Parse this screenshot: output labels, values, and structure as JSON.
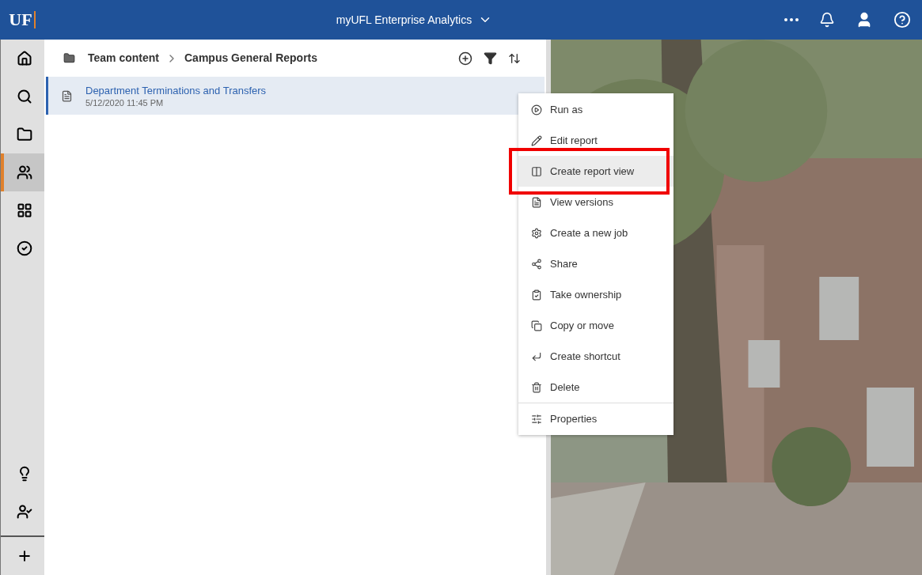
{
  "top_bar": {
    "logo": "UF",
    "title": "myUFL Enterprise Analytics"
  },
  "sidebar": {
    "items": [
      {
        "kind": "home",
        "selected": false
      },
      {
        "kind": "search",
        "selected": false
      },
      {
        "kind": "my-content",
        "selected": false
      },
      {
        "kind": "team-content",
        "selected": true
      },
      {
        "kind": "layout",
        "selected": false
      },
      {
        "kind": "check",
        "selected": false
      }
    ],
    "bottom_items": [
      {
        "kind": "bulb",
        "selected": false
      },
      {
        "kind": "user",
        "selected": false
      },
      {
        "kind": "plus",
        "selected": false
      }
    ]
  },
  "breadcrumb": [
    "Team content",
    "Campus General Reports"
  ],
  "files": [
    {
      "name": "Department Terminations and Transfers",
      "modified": "5/12/2020 11:45 PM",
      "selected": true
    }
  ],
  "context_menu": {
    "items": [
      {
        "kind": "run",
        "label": "Run as",
        "hovered": false,
        "outlined": false
      },
      {
        "kind": "edit",
        "label": "Edit report",
        "hovered": false,
        "outlined": false
      },
      {
        "kind": "report-view",
        "label": "Create report view",
        "hovered": true,
        "outlined": true
      },
      {
        "kind": "versions",
        "label": "View versions",
        "hovered": false,
        "outlined": false
      },
      {
        "kind": "job",
        "label": "Create a new job",
        "hovered": false,
        "outlined": false
      },
      {
        "kind": "share",
        "label": "Share",
        "hovered": false,
        "outlined": false
      },
      {
        "kind": "ownership",
        "label": "Take ownership",
        "hovered": false,
        "outlined": false
      },
      {
        "kind": "copy",
        "label": "Copy or move",
        "hovered": false,
        "outlined": false
      },
      {
        "kind": "shortcut",
        "label": "Create shortcut",
        "hovered": false,
        "outlined": false
      },
      {
        "kind": "delete",
        "label": "Delete",
        "hovered": false,
        "outlined": false
      },
      {
        "kind": "properties",
        "label": "Properties",
        "hovered": false,
        "outlined": false
      }
    ]
  }
}
